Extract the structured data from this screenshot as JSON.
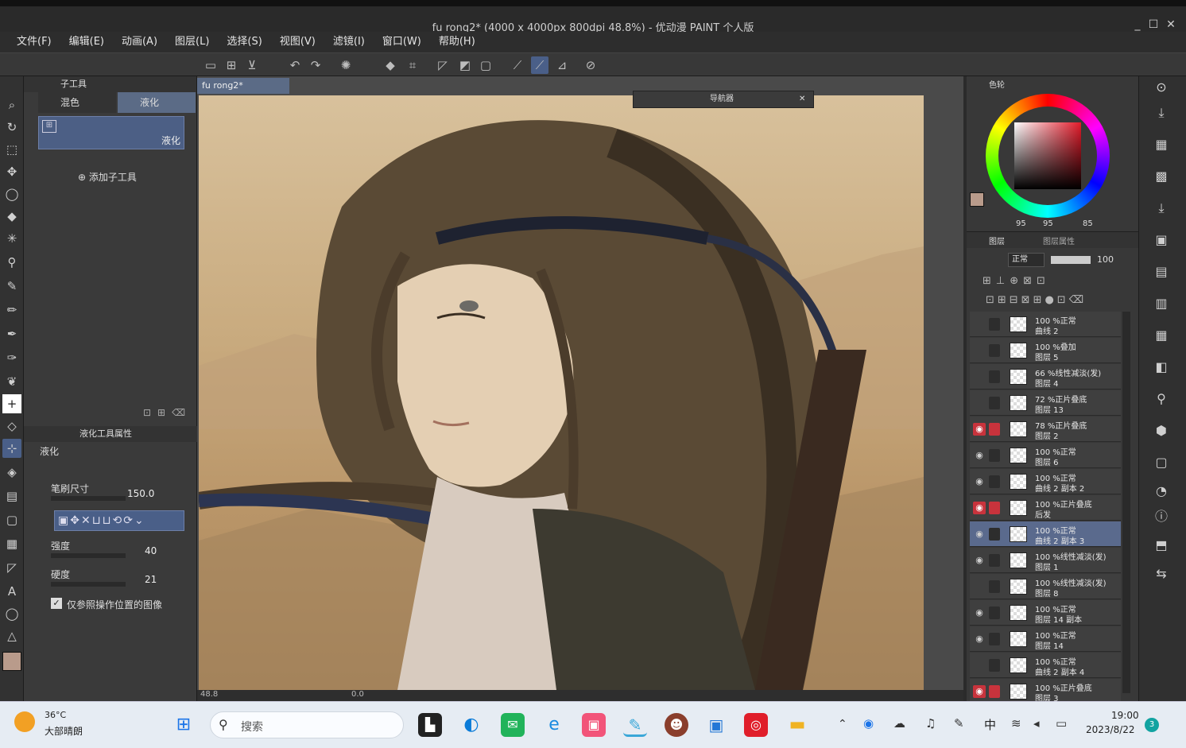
{
  "window": {
    "title": "fu rong2* (4000 x 4000px 800dpi 48.8%)  - 优动漫 PAINT 个人版",
    "controls": [
      "_",
      "☐",
      "✕"
    ]
  },
  "menu": [
    "文件(F)",
    "编辑(E)",
    "动画(A)",
    "图层(L)",
    "选择(S)",
    "视图(V)",
    "滤镜(I)",
    "窗口(W)",
    "帮助(H)"
  ],
  "subtool_panel": {
    "header": "子工具",
    "tabs": [
      "混色",
      "液化"
    ],
    "selected_tool": "液化",
    "add_subtool": "添加子工具"
  },
  "tool_property": {
    "header": "液化工具属性",
    "tool_name": "液化",
    "brush_size_label": "笔刷尺寸",
    "brush_size_value": "150.0",
    "strength_label": "强度",
    "strength_value": "40",
    "hardness_label": "硬度",
    "hardness_value": "21",
    "ref_checkbox_label": "仅参照操作位置的图像",
    "ref_checked": true
  },
  "document": {
    "tab": "fu rong2*",
    "nav_title": "导航器",
    "status_zoom": "48.8",
    "status_angle": "0.0"
  },
  "color_panel": {
    "header": "色轮",
    "r": "95",
    "g": "95",
    "b": "85",
    "accent_color": "#c8333c"
  },
  "layer_panel": {
    "tabs": [
      "图层",
      "图层属性"
    ],
    "blend_mode": "正常",
    "opacity": "100",
    "layers": [
      {
        "l1": "100 %正常",
        "l2": "曲线 2",
        "eye": false,
        "red": false,
        "sel": false
      },
      {
        "l1": "100 %叠加",
        "l2": "图层 5",
        "eye": false,
        "red": false,
        "sel": false
      },
      {
        "l1": "66 %线性减淡(发)",
        "l2": "图层 4",
        "eye": false,
        "red": false,
        "sel": false
      },
      {
        "l1": "72 %正片叠底",
        "l2": "图层 13",
        "eye": false,
        "red": false,
        "sel": false
      },
      {
        "l1": "78 %正片叠底",
        "l2": "图层 2",
        "eye": true,
        "red": true,
        "sel": false
      },
      {
        "l1": "100 %正常",
        "l2": "图层 6",
        "eye": true,
        "red": false,
        "sel": false
      },
      {
        "l1": "100 %正常",
        "l2": "曲线 2 副本 2",
        "eye": true,
        "red": false,
        "sel": false
      },
      {
        "l1": "100 %正片叠底",
        "l2": "后发",
        "eye": true,
        "red": true,
        "sel": false
      },
      {
        "l1": "100 %正常",
        "l2": "曲线 2 副本 3",
        "eye": true,
        "red": false,
        "sel": true
      },
      {
        "l1": "100 %线性减淡(发)",
        "l2": "图层 1",
        "eye": true,
        "red": false,
        "sel": false
      },
      {
        "l1": "100 %线性减淡(发)",
        "l2": "图层 8",
        "eye": false,
        "red": false,
        "sel": false
      },
      {
        "l1": "100 %正常",
        "l2": "图层 14 副本",
        "eye": true,
        "red": false,
        "sel": false
      },
      {
        "l1": "100 %正常",
        "l2": "图层 14",
        "eye": true,
        "red": false,
        "sel": false
      },
      {
        "l1": "100 %正常",
        "l2": "曲线 2 副本 4",
        "eye": false,
        "red": false,
        "sel": false
      },
      {
        "l1": "100 %正片叠底",
        "l2": "图层 3",
        "eye": true,
        "red": true,
        "sel": false
      }
    ]
  },
  "taskbar": {
    "weather_temp": "36°C",
    "weather_desc": "大部晴朗",
    "search_placeholder": "搜索",
    "ime": "中",
    "time": "19:00",
    "date": "2023/8/22",
    "notif_count": "3"
  }
}
